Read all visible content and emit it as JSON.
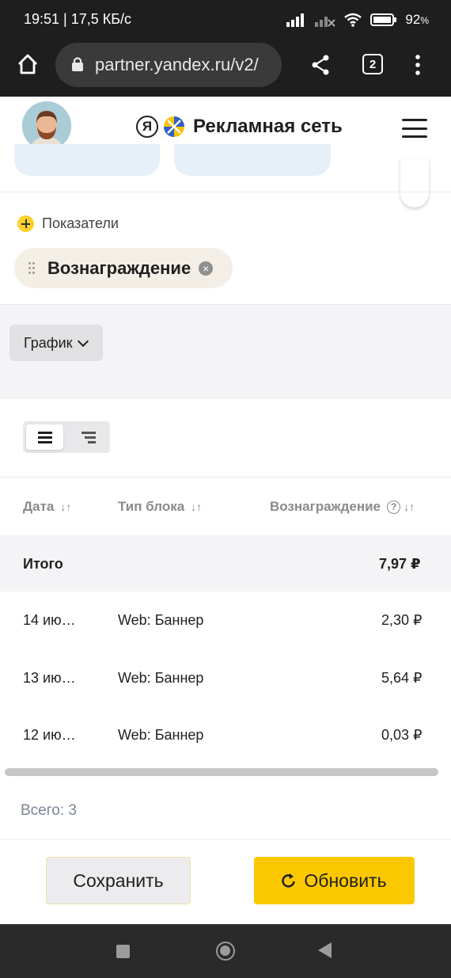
{
  "status_bar": {
    "time": "19:51 | 17,5 КБ/с",
    "battery": "92"
  },
  "browser": {
    "url": "partner.yandex.ru/v2/",
    "tab_count": "2"
  },
  "header": {
    "brand_letter": "Я",
    "brand_name": "Рекламная сеть"
  },
  "metrics": {
    "label": "Показатели",
    "chips": [
      {
        "label": "Вознаграждение"
      }
    ]
  },
  "view": {
    "mode_label": "График"
  },
  "table": {
    "columns": [
      "Дата",
      "Тип блока",
      "Вознаграждение"
    ],
    "total_row": {
      "label": "Итого",
      "value": "7,97 ₽"
    },
    "rows": [
      {
        "date": "14 ию…",
        "type": "Web: Баннер",
        "value": "2,30 ₽"
      },
      {
        "date": "13 ию…",
        "type": "Web: Баннер",
        "value": "5,64 ₽"
      },
      {
        "date": "12 ию…",
        "type": "Web: Баннер",
        "value": "0,03 ₽"
      }
    ],
    "count_text": "Всего: 3"
  },
  "actions": {
    "save_label": "Сохранить",
    "refresh_label": "Обновить"
  },
  "colors": {
    "accent_yellow": "#fbc800",
    "chip_bg": "#f3efe6"
  }
}
